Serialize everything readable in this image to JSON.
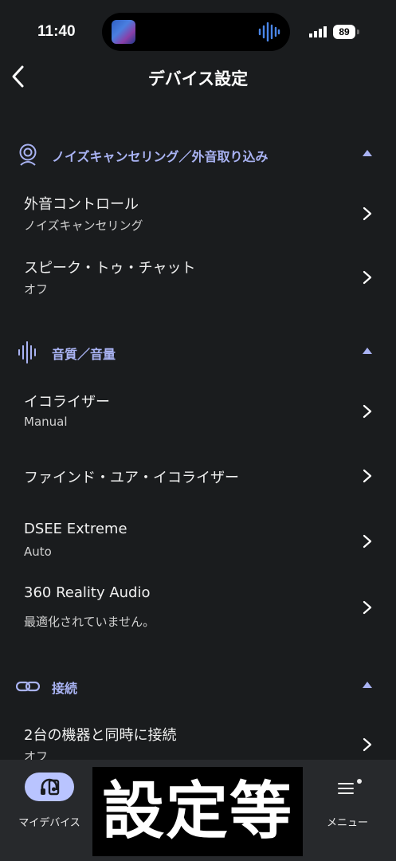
{
  "status_bar": {
    "time": "11:40",
    "battery": "89"
  },
  "header": {
    "title": "デバイス設定"
  },
  "sections": [
    {
      "title": "ノイズキャンセリング／外音取り込み",
      "icon": "head-profile-icon",
      "items": [
        {
          "label": "外音コントロール",
          "value": "ノイズキャンセリング"
        },
        {
          "label": "スピーク・トゥ・チャット",
          "value": "オフ"
        }
      ]
    },
    {
      "title": "音質／音量",
      "icon": "sound-wave-icon",
      "items": [
        {
          "label": "イコライザー",
          "value": "Manual"
        },
        {
          "label": "ファインド・ユア・イコライザー",
          "value": ""
        },
        {
          "label": "DSEE Extreme",
          "value": "Auto"
        },
        {
          "label": "360 Reality Audio",
          "value": "最適化されていません。"
        }
      ]
    },
    {
      "title": "接続",
      "icon": "link-icon",
      "items": [
        {
          "label": "2台の機器と同時に接続",
          "value": "オフ"
        }
      ]
    }
  ],
  "bottom_nav": {
    "my_device": "マイデバイス",
    "menu": "メニュー"
  },
  "overlay": {
    "caption": "設定等"
  },
  "colors": {
    "background": "#1a1c1e",
    "accent": "#a9b3f3",
    "nav_active": "#b9c4ff",
    "nav_bar": "#27292c"
  }
}
